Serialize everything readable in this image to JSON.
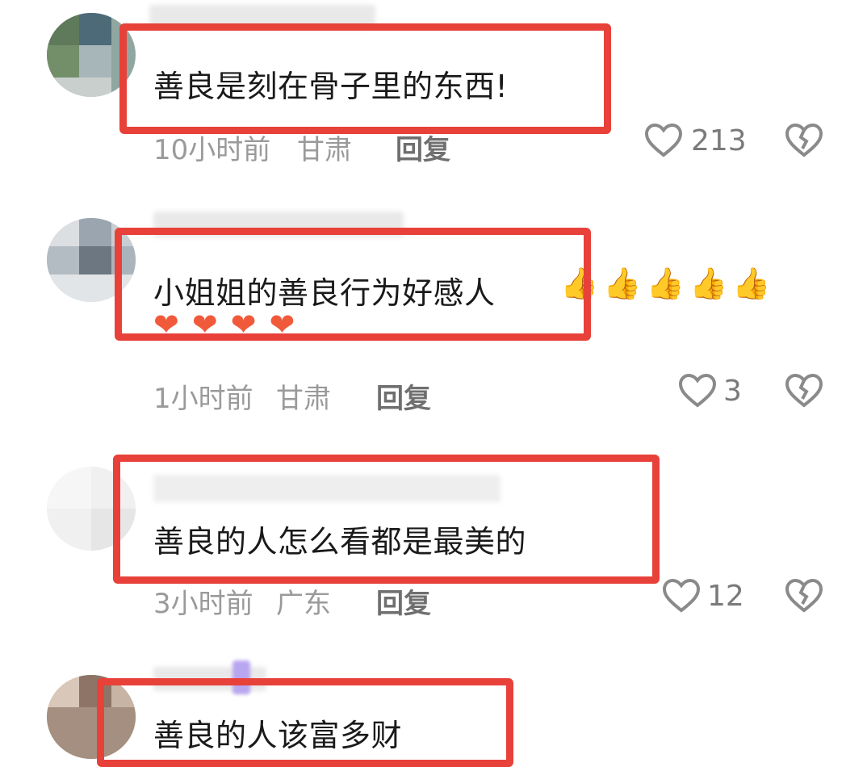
{
  "colors": {
    "highlight": "#e8413a",
    "meta_text": "#9a9a9a",
    "icon": "#8a8a8a"
  },
  "comments": [
    {
      "text": "善良是刻在骨子里的东西!",
      "time": "10小时前",
      "location": "甘肃",
      "reply_label": "回复",
      "likes": "213"
    },
    {
      "text": "小姐姐的善良行为好感人",
      "emoji_thumbs": "👍👍👍👍👍",
      "emoji_hearts": "❤❤❤❤",
      "time": "1小时前",
      "location": "甘肃",
      "reply_label": "回复",
      "likes": "3"
    },
    {
      "text": "善良的人怎么看都是最美的",
      "time": "3小时前",
      "location": "广东",
      "reply_label": "回复",
      "likes": "12"
    },
    {
      "text": "善良的人该富多财"
    }
  ],
  "icons": {
    "like": "heart-outline-icon",
    "dislike": "broken-heart-icon"
  }
}
